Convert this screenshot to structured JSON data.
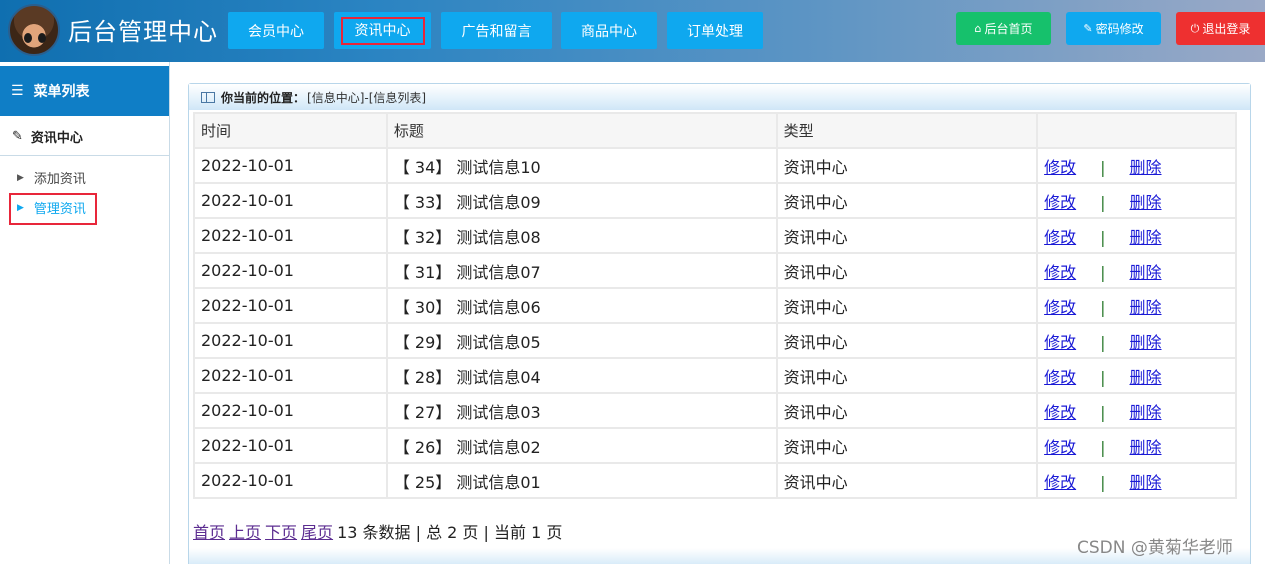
{
  "header": {
    "site_title": "后台管理中心",
    "nav": [
      {
        "label": "会员中心"
      },
      {
        "label": "资讯中心"
      },
      {
        "label": "广告和留言"
      },
      {
        "label": "商品中心"
      },
      {
        "label": "订单处理"
      }
    ],
    "active_nav": "资讯中心",
    "home_btn": {
      "label": "后台首页",
      "icon": "home-icon",
      "color": "#16c16c"
    },
    "pwd_btn": {
      "label": "密码修改",
      "icon": "wrench-icon",
      "color": "#0fa8ef"
    },
    "logout_btn": {
      "label": "退出登录",
      "icon": "power-icon",
      "color": "#ee3030"
    }
  },
  "sidebar": {
    "menu_title": "菜单列表",
    "section_title": "资讯中心",
    "items": [
      {
        "label": "添加资讯"
      },
      {
        "label": "管理资讯"
      }
    ],
    "active_item": "管理资讯"
  },
  "main": {
    "breadcrumb_label": "你当前的位置：",
    "breadcrumb_path": "[信息中心]-[信息列表]",
    "table": {
      "columns": [
        "时间",
        "标题",
        "类型",
        ""
      ],
      "rows": [
        {
          "time": "2022-10-01",
          "title": "【 34】 测试信息10",
          "type": "资讯中心"
        },
        {
          "time": "2022-10-01",
          "title": "【 33】 测试信息09",
          "type": "资讯中心"
        },
        {
          "time": "2022-10-01",
          "title": "【 32】 测试信息08",
          "type": "资讯中心"
        },
        {
          "time": "2022-10-01",
          "title": "【 31】 测试信息07",
          "type": "资讯中心"
        },
        {
          "time": "2022-10-01",
          "title": "【 30】 测试信息06",
          "type": "资讯中心"
        },
        {
          "time": "2022-10-01",
          "title": "【 29】 测试信息05",
          "type": "资讯中心"
        },
        {
          "time": "2022-10-01",
          "title": "【 28】 测试信息04",
          "type": "资讯中心"
        },
        {
          "time": "2022-10-01",
          "title": "【 27】 测试信息03",
          "type": "资讯中心"
        },
        {
          "time": "2022-10-01",
          "title": "【 26】 测试信息02",
          "type": "资讯中心"
        },
        {
          "time": "2022-10-01",
          "title": "【 25】 测试信息01",
          "type": "资讯中心"
        }
      ],
      "edit_label": "修改",
      "separator": "|",
      "delete_label": "删除"
    },
    "pager": {
      "first": "首页",
      "prev": "上页",
      "next": "下页",
      "last": "尾页",
      "summary": "13 条数据 | 总 2 页 | 当前 1 页"
    }
  },
  "watermark": "CSDN @黄菊华老师"
}
